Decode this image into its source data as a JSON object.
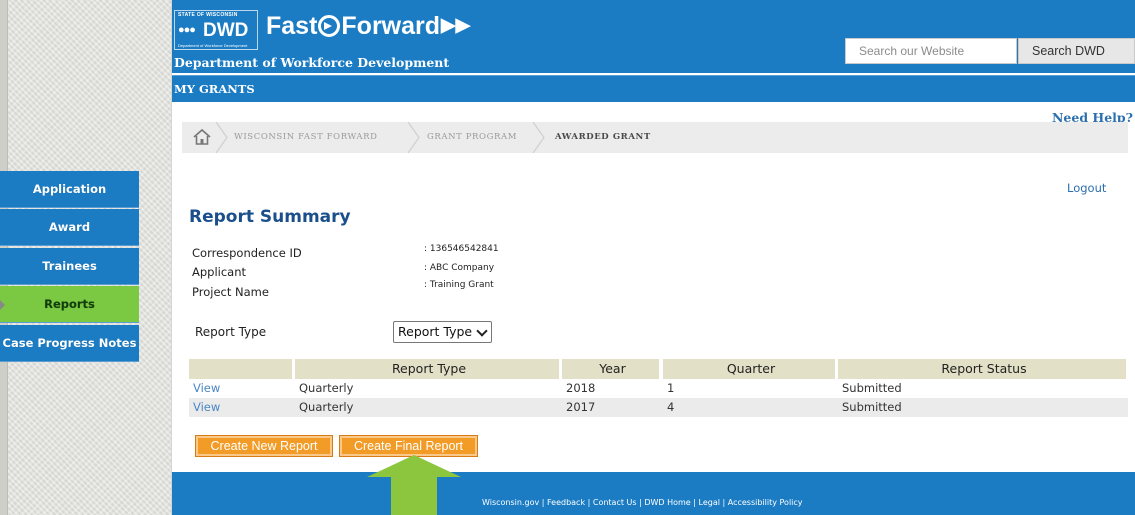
{
  "header": {
    "logo_state": "STATE OF WISCONSIN",
    "logo_dwd": "DWD",
    "logo_sub": "Department of Workforce Development",
    "program_logo_prefix": "Fast",
    "program_logo_suffix": "Forward",
    "department": "Department of Workforce Development",
    "search_placeholder": "Search our Website",
    "search_button": "Search DWD"
  },
  "section_bar": {
    "title": "MY GRANTS"
  },
  "need_help": "Need Help?",
  "breadcrumb": {
    "items": [
      "WISCONSIN FAST FORWARD",
      "GRANT PROGRAM",
      "AWARDED GRANT"
    ]
  },
  "logout": "Logout",
  "sidebar": {
    "items": [
      {
        "label": "Application"
      },
      {
        "label": "Award"
      },
      {
        "label": "Trainees"
      },
      {
        "label": "Reports"
      },
      {
        "label": "Case Progress Notes"
      }
    ],
    "active_index": 3
  },
  "summary": {
    "title": "Report Summary",
    "fields": [
      {
        "label": "Correspondence ID",
        "value": ": 136546542841"
      },
      {
        "label": "Applicant",
        "value": ": ABC Company"
      },
      {
        "label": "Project Name",
        "value": ": Training Grant"
      }
    ]
  },
  "report_type": {
    "label": "Report Type",
    "selected": "Report Type"
  },
  "table": {
    "headers": [
      "",
      "Report Type",
      "Year",
      "Quarter",
      "Report Status"
    ],
    "rows": [
      {
        "action": "View",
        "type": "Quarterly",
        "year": "2018",
        "quarter": "1",
        "status": "Submitted"
      },
      {
        "action": "View",
        "type": "Quarterly",
        "year": "2017",
        "quarter": "4",
        "status": "Submitted"
      }
    ]
  },
  "buttons": {
    "create_new": "Create New Report",
    "create_final": "Create Final Report"
  },
  "footer": {
    "links": "Wisconsin.gov | Feedback | Contact Us | DWD Home | Legal | Accessibility Policy"
  },
  "colors": {
    "brand_blue": "#1b7cc4",
    "active_green": "#7bc842",
    "button_orange": "#f29b26",
    "annotation_arrow": "#8cc63f"
  }
}
